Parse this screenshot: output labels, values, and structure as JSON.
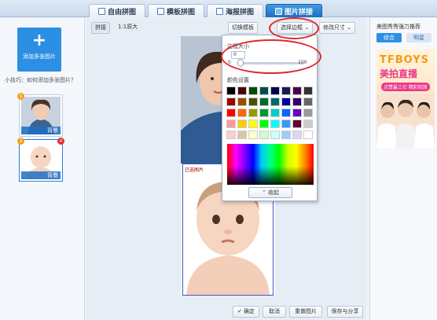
{
  "tabs": [
    {
      "label": "自由拼图"
    },
    {
      "label": "模板拼图"
    },
    {
      "label": "海报拼图"
    },
    {
      "label": "图片拼接"
    }
  ],
  "left_panel": {
    "add_button": "添加多张图片",
    "tip": "小技巧：如何添加多张图片？",
    "thumbnails": [
      {
        "caption": "背景",
        "badge": "1"
      },
      {
        "caption": "背景",
        "badge": "2"
      }
    ]
  },
  "toolbar": {
    "mode_buttons": [
      "拼接",
      "1:1原大"
    ],
    "template_button": "切换模板",
    "border_button": "选择边框",
    "resize_button": "修改尺寸"
  },
  "photo_badge": "已选图片",
  "popup": {
    "size_label": "边框大小",
    "size_value": "0",
    "slider_value": 0,
    "slider_min": "0",
    "slider_max": "100",
    "color_label": "颜色设置",
    "swatches": [
      "#000000",
      "#4d0000",
      "#004d00",
      "#004d4d",
      "#00004d",
      "#1a1a4d",
      "#4d004d",
      "#333333",
      "#990000",
      "#994d00",
      "#4d4d00",
      "#006633",
      "#006666",
      "#000099",
      "#330066",
      "#666666",
      "#ff0000",
      "#ff6600",
      "#999900",
      "#009933",
      "#00cccc",
      "#0066ff",
      "#6600cc",
      "#999999",
      "#ff9999",
      "#ffcc00",
      "#ffff00",
      "#00ff00",
      "#00ffff",
      "#3399ff",
      "#660033",
      "#cccccc",
      "#ffcccc",
      "#d9c7a6",
      "#ffffcc",
      "#ccffcc",
      "#ccffff",
      "#99ccff",
      "#ddd6f2",
      "#ffffff"
    ],
    "collapse_button": "收起"
  },
  "bottom_buttons": {
    "confirm": "确定",
    "cancel": "取消",
    "reset": "重做图片",
    "save": "保存与分享"
  },
  "right_panel": {
    "title": "美图秀秀强力推荐",
    "tabs": [
      "综合",
      "明星"
    ],
    "ad_line1": "TFBOYS",
    "ad_line2": "美拍直播",
    "ad_line3": "点赞最三亿 精彩回放"
  }
}
